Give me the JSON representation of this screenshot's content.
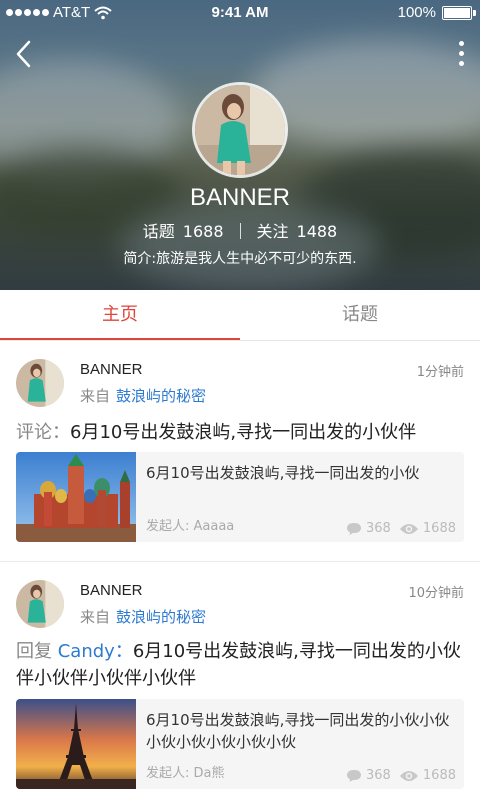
{
  "status_bar": {
    "carrier": "AT&T",
    "time": "9:41 AM",
    "battery": "100%"
  },
  "profile": {
    "name": "BANNER",
    "topics_label": "话题",
    "topics_count": "1688",
    "follow_label": "关注",
    "follow_count": "1488",
    "intro": "简介:旅游是我人生中必不可少的东西."
  },
  "tabs": [
    {
      "label": "主页",
      "active": true
    },
    {
      "label": "话题",
      "active": false
    }
  ],
  "colors": {
    "accent": "#e0453a",
    "link": "#2e7ad1"
  },
  "feed": [
    {
      "author": "BANNER",
      "from_label": "来自",
      "topic": "鼓浪屿的秘密",
      "time": "1分钟前",
      "action_label": "评论：",
      "reply_user": "",
      "text": "6月10号出发鼓浪屿,寻找一同出发的小伙伴",
      "share": {
        "title": "6月10号出发鼓浪屿,寻找一同出发的小伙",
        "initiator": "发起人: Aaaaa",
        "comments": "368",
        "views": "1688",
        "thumb_icon": "cathedral-photo"
      }
    },
    {
      "author": "BANNER",
      "from_label": "来自",
      "topic": "鼓浪屿的秘密",
      "time": "10分钟前",
      "action_label": "回复 ",
      "reply_user": "Candy：",
      "text": "6月10号出发鼓浪屿,寻找一同出发的小伙伴小伙伴小伙伴小伙伴",
      "share": {
        "title": "6月10号出发鼓浪屿,寻找一同出发的小伙小伙小伙小伙小伙小伙小伙",
        "initiator": "发起人: Da熊",
        "comments": "368",
        "views": "1688",
        "thumb_icon": "eiffel-tower-photo"
      }
    }
  ]
}
